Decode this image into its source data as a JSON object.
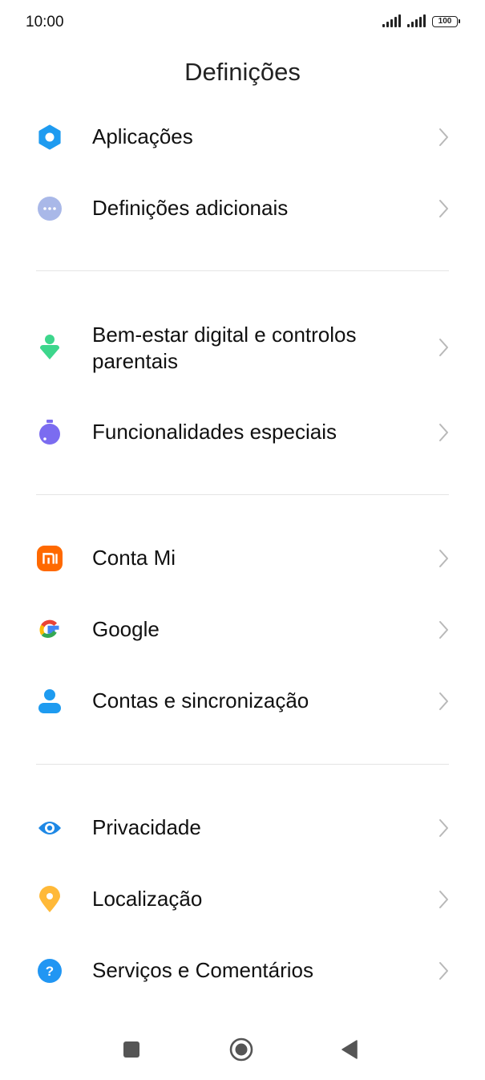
{
  "status_bar": {
    "time": "10:00",
    "battery": "100"
  },
  "header": {
    "title": "Definições"
  },
  "items": [
    {
      "label": "Aplicações",
      "icon": "gear-icon",
      "color": "#1E9BF0"
    },
    {
      "label": "Definições adicionais",
      "icon": "more-dots-icon",
      "color": "#A9B8E8"
    },
    {
      "label": "Bem-estar digital e controlos parentais",
      "icon": "wellbeing-icon",
      "color": "#3DD68C"
    },
    {
      "label": "Funcionalidades especiais",
      "icon": "special-features-icon",
      "color": "#7B6CF0"
    },
    {
      "label": "Conta Mi",
      "icon": "mi-logo-icon",
      "color": "#FF6900"
    },
    {
      "label": "Google",
      "icon": "google-logo-icon",
      "color": "#4285F4"
    },
    {
      "label": "Contas e sincronização",
      "icon": "person-icon",
      "color": "#1E9BF0"
    },
    {
      "label": "Privacidade",
      "icon": "eye-icon",
      "color": "#1E88E5"
    },
    {
      "label": "Localização",
      "icon": "location-pin-icon",
      "color": "#FFB938"
    },
    {
      "label": "Serviços e Comentários",
      "icon": "help-icon",
      "color": "#2196F3"
    }
  ],
  "nav": {
    "recents": "recents-icon",
    "home": "home-icon",
    "back": "back-icon"
  }
}
